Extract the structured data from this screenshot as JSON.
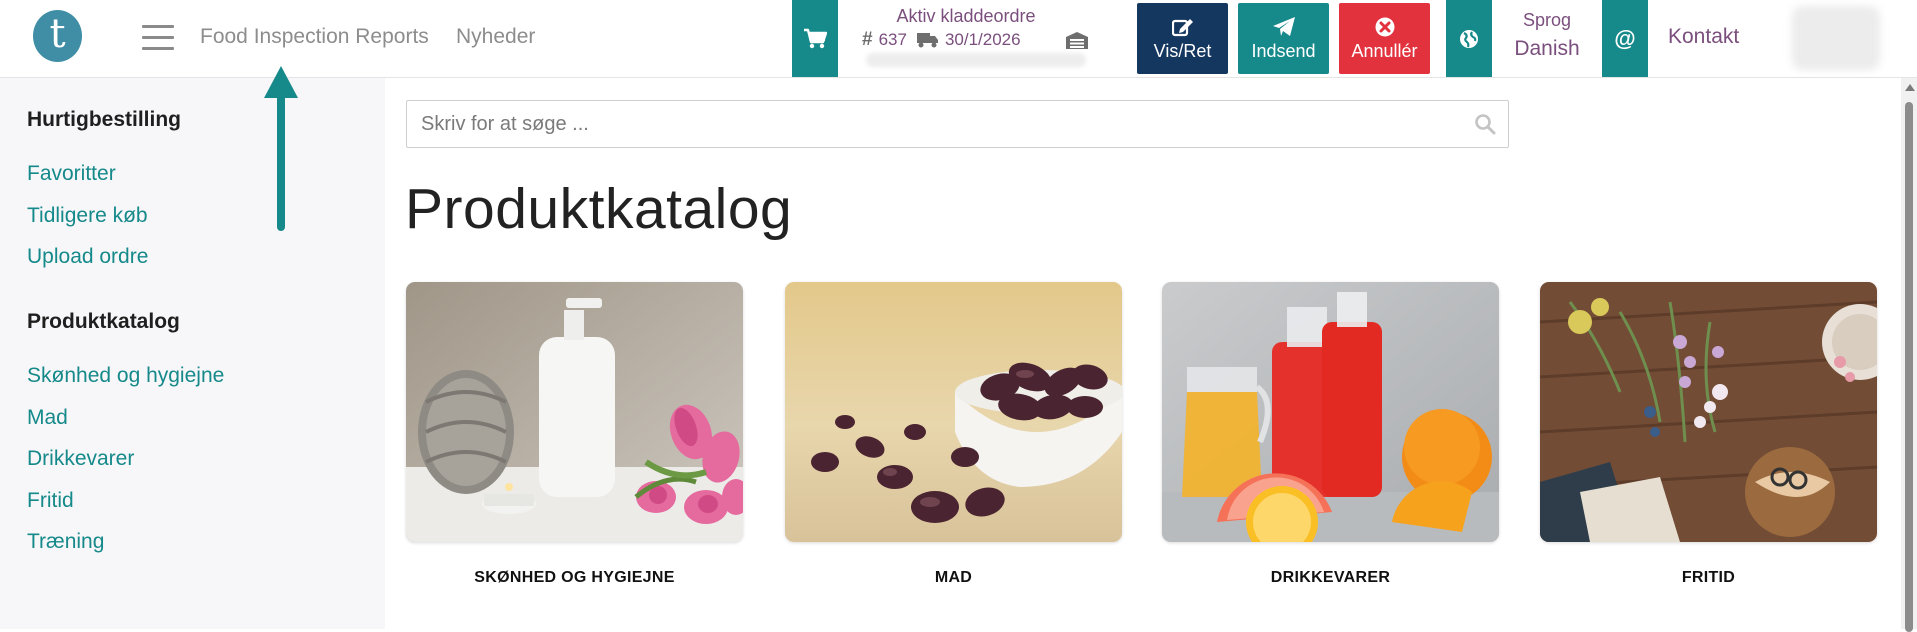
{
  "header": {
    "logo_letter": "t",
    "nav": {
      "food_inspection": "Food Inspection Reports",
      "news": "Nyheder"
    },
    "order": {
      "title": "Aktiv kladdeordre",
      "number_symbol": "#",
      "number": "637",
      "date": "30/1/2026"
    },
    "buttons": {
      "view_edit": "Vis/Ret",
      "submit": "Indsend",
      "cancel": "Annullér"
    },
    "language": {
      "label": "Sprog",
      "value": "Danish"
    },
    "contact": {
      "at_symbol": "@",
      "label": "Kontakt"
    }
  },
  "sidebar": {
    "quick_order": {
      "heading": "Hurtigbestilling",
      "items": [
        {
          "label": "Favoritter"
        },
        {
          "label": "Tidligere køb"
        },
        {
          "label": "Upload ordre"
        }
      ]
    },
    "catalog": {
      "heading": "Produktkatalog",
      "items": [
        {
          "label": "Skønhed og hygiejne"
        },
        {
          "label": "Mad"
        },
        {
          "label": "Drikkevarer"
        },
        {
          "label": "Fritid"
        },
        {
          "label": "Træning"
        }
      ]
    }
  },
  "main": {
    "search": {
      "placeholder": "Skriv for at søge ..."
    },
    "title": "Produktkatalog",
    "categories": [
      {
        "label": "SKØNHED OG HYGIEJNE",
        "image": "towel-soap-tulips"
      },
      {
        "label": "MAD",
        "image": "dates-bowl"
      },
      {
        "label": "DRIKKEVARER",
        "image": "juice-bottles-citrus"
      },
      {
        "label": "FRITID",
        "image": "flowers-on-wood-table"
      }
    ]
  },
  "colors": {
    "teal": "#16898a",
    "navy": "#14375f",
    "red": "#e2323d",
    "purple_text": "#7b4f7d"
  }
}
